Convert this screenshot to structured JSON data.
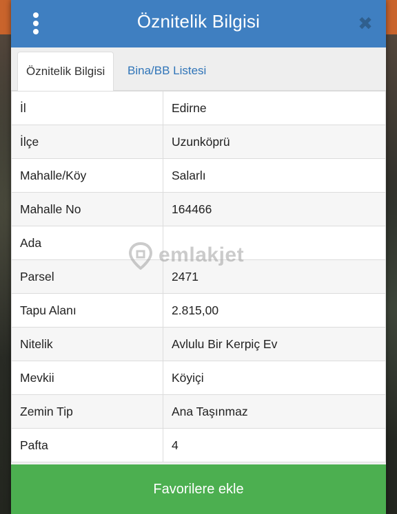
{
  "header": {
    "title": "Öznitelik Bilgisi"
  },
  "tabs": [
    {
      "label": "Öznitelik Bilgisi",
      "active": true
    },
    {
      "label": "Bina/BB Listesi",
      "active": false
    }
  ],
  "attributes": [
    {
      "label": "İl",
      "value": "Edirne"
    },
    {
      "label": "İlçe",
      "value": "Uzunköprü"
    },
    {
      "label": "Mahalle/Köy",
      "value": "Salarlı"
    },
    {
      "label": "Mahalle No",
      "value": "164466"
    },
    {
      "label": "Ada",
      "value": ""
    },
    {
      "label": "Parsel",
      "value": "2471"
    },
    {
      "label": "Tapu Alanı",
      "value": "2.815,00"
    },
    {
      "label": "Nitelik",
      "value": "Avlulu Bir Kerpiç Ev"
    },
    {
      "label": "Mevkii",
      "value": "Köyiçi"
    },
    {
      "label": "Zemin Tip",
      "value": "Ana Taşınmaz"
    },
    {
      "label": "Pafta",
      "value": "4"
    }
  ],
  "watermark": {
    "text": "emlakjet"
  },
  "footer": {
    "favorite_label": "Favorilere ekle"
  },
  "colors": {
    "header": "#3f7fc1",
    "tab_link": "#2f74b8",
    "button": "#4caf50",
    "close_icon": "#2f5f8e"
  }
}
